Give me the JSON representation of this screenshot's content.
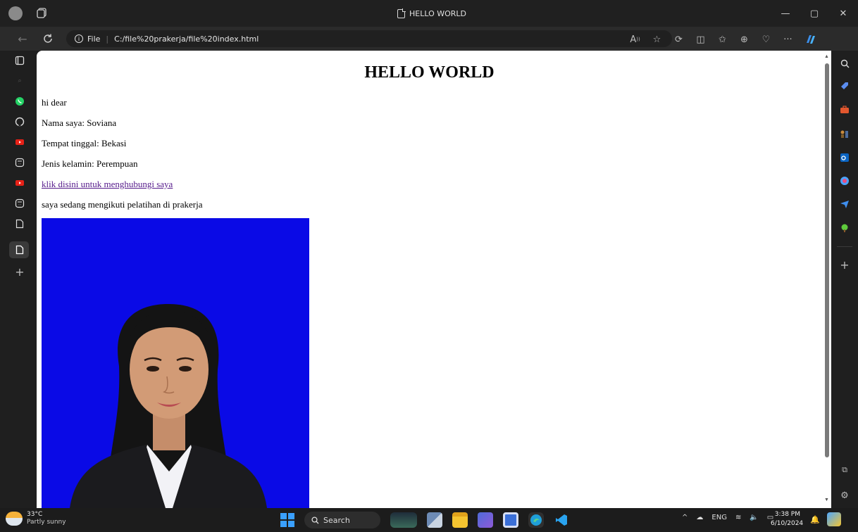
{
  "browser": {
    "tab_title": "HELLO WORLD",
    "address_prefix": "File",
    "url": "C:/file%20prakerja/file%20index.html",
    "window_buttons": {
      "minimize": "—",
      "restore": "▢",
      "close": "✕"
    }
  },
  "page": {
    "heading": "HELLO WORLD",
    "greeting": "hi dear",
    "name_line": "Nama saya: Soviana",
    "residence_line": "Tempat tinggal: Bekasi",
    "gender_line": "Jenis kelamin: Perempuan",
    "contact_link": "klik disini untuk menghubungi saya",
    "training_line": "saya sedang mengikuti pelatihan di prakerja",
    "photo_background": "#0a0ae6"
  },
  "taskbar": {
    "temperature": "33°C",
    "weather": "Partly sunny",
    "search_label": "Search",
    "language": "ENG",
    "time": "3:38 PM",
    "date": "6/10/2024"
  },
  "icons": {
    "left_rail": [
      "tab-actions-icon",
      "search-icon",
      "whatsapp-icon",
      "github-icon",
      "youtube-icon",
      "page-icon",
      "youtube-icon",
      "page-icon",
      "tab-icon",
      "tab-active-icon",
      "add-icon"
    ],
    "right_rail": [
      "search-icon",
      "tag-icon",
      "tools-icon",
      "games-icon",
      "outlook-icon",
      "office-icon",
      "send-icon",
      "tree-icon",
      "add-icon",
      "screenshot-icon",
      "settings-icon"
    ]
  }
}
